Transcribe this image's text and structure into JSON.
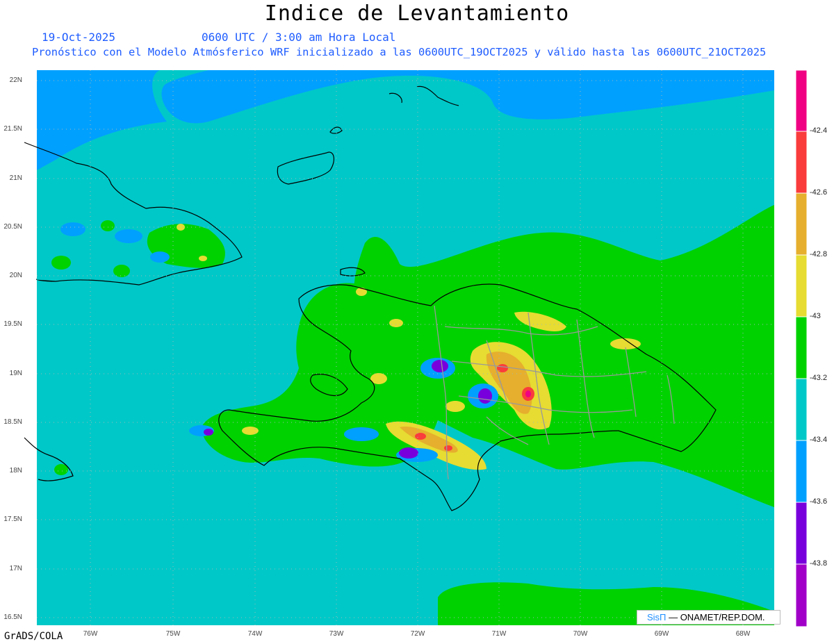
{
  "header": {
    "title": "Indice de Levantamiento",
    "date": "19-Oct-2025",
    "time": "0600 UTC / 3:00 am Hora Local",
    "forecast": "Pronóstico con el Modelo Atmósferico WRF inicializado a las 0600UTC_19OCT2025 y válido hasta las  0600UTC_21OCT2025"
  },
  "map": {
    "lat_labels": [
      "22N",
      "21.5N",
      "21N",
      "20.5N",
      "20N",
      "19.5N",
      "19N",
      "18.5N",
      "18N",
      "17.5N",
      "17N",
      "16.5N"
    ],
    "lon_labels": [
      "76W",
      "75W",
      "74W",
      "73W",
      "72W",
      "71W",
      "70W",
      "69W",
      "68W"
    ],
    "background_levels": {
      "blue": "#00a0ff",
      "cyan": "#00c8c8",
      "green": "#00d200",
      "yellow": "#e6dc32",
      "orange": "#e6af2d",
      "red": "#fa3c3c",
      "magenta": "#f00082",
      "purple": "#7800dc",
      "violet": "#a000c8"
    }
  },
  "colorbar": {
    "labels": [
      "-42.4",
      "-42.6",
      "-42.8",
      "-43",
      "-43.2",
      "-43.4",
      "-43.6",
      "-43.8"
    ],
    "colors": [
      "#f00082",
      "#fa3c3c",
      "#e6af2d",
      "#e6dc32",
      "#00d200",
      "#00c8c8",
      "#00a0ff",
      "#7800dc",
      "#a000c8"
    ]
  },
  "footer": {
    "software": "GrADS/COLA",
    "credit_sis": "SisΠ",
    "credit_org": "— ONAMET/REP.DOM."
  }
}
